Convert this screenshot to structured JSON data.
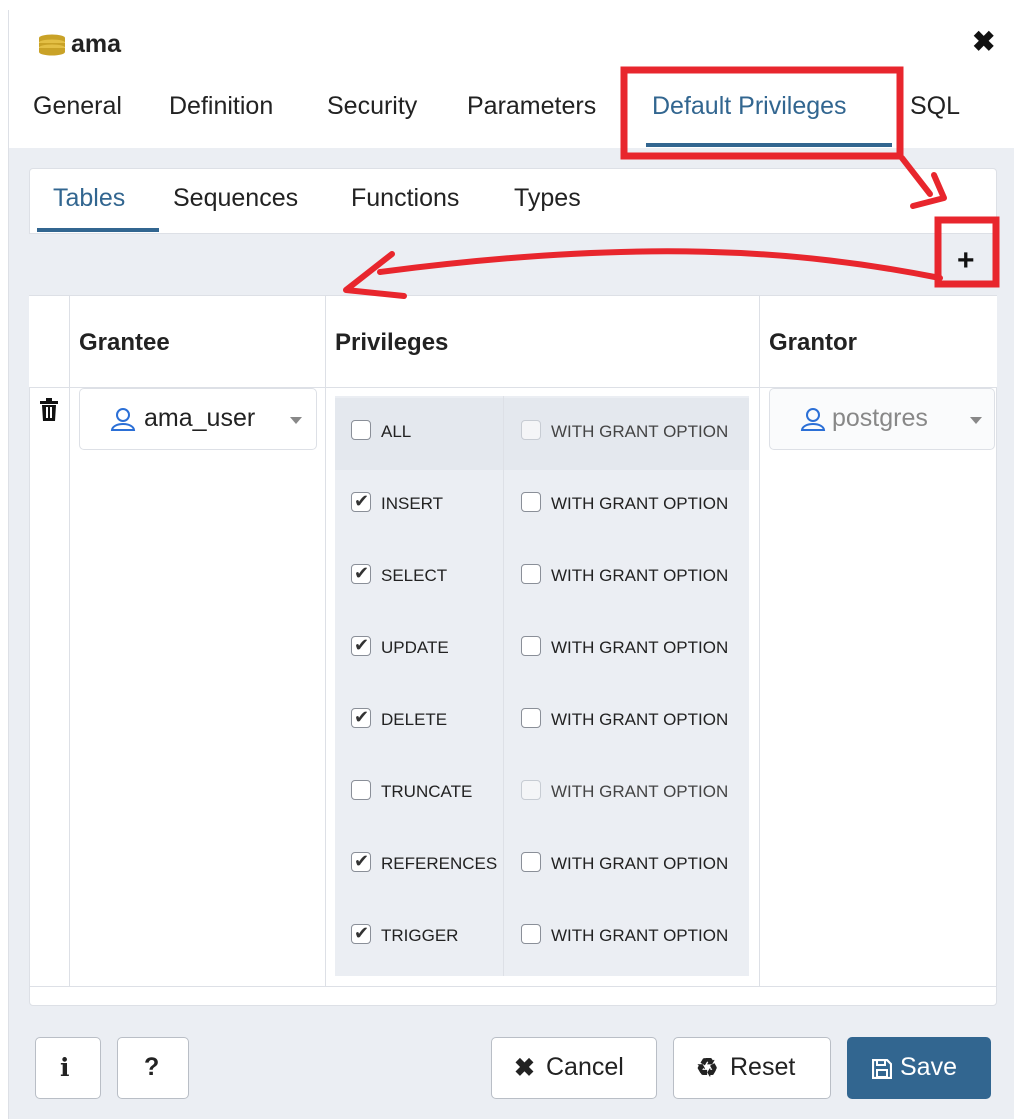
{
  "dialog": {
    "title": "ama",
    "title_icon": "database-icon",
    "close_icon": "close-icon"
  },
  "top_tabs": [
    {
      "label": "General"
    },
    {
      "label": "Definition"
    },
    {
      "label": "Security"
    },
    {
      "label": "Parameters"
    },
    {
      "label": "Default Privileges",
      "active": true
    },
    {
      "label": "SQL"
    }
  ],
  "sub_tabs": [
    {
      "label": "Tables",
      "active": true
    },
    {
      "label": "Sequences"
    },
    {
      "label": "Functions"
    },
    {
      "label": "Types"
    }
  ],
  "toolbar": {
    "add_icon": "plus-icon"
  },
  "grid": {
    "headers": {
      "grantee": "Grantee",
      "privileges": "Privileges",
      "grantor": "Grantor"
    },
    "row": {
      "delete_icon": "trash-icon",
      "grantee": "ama_user",
      "grantor": "postgres",
      "privileges": [
        {
          "name": "ALL",
          "checked": false,
          "grant_label": "WITH GRANT OPTION",
          "grant_checked": false,
          "grant_disabled": true
        },
        {
          "name": "INSERT",
          "checked": true,
          "grant_label": "WITH GRANT OPTION",
          "grant_checked": false,
          "grant_disabled": false
        },
        {
          "name": "SELECT",
          "checked": true,
          "grant_label": "WITH GRANT OPTION",
          "grant_checked": false,
          "grant_disabled": false
        },
        {
          "name": "UPDATE",
          "checked": true,
          "grant_label": "WITH GRANT OPTION",
          "grant_checked": false,
          "grant_disabled": false
        },
        {
          "name": "DELETE",
          "checked": true,
          "grant_label": "WITH GRANT OPTION",
          "grant_checked": false,
          "grant_disabled": false
        },
        {
          "name": "TRUNCATE",
          "checked": false,
          "grant_label": "WITH GRANT OPTION",
          "grant_checked": false,
          "grant_disabled": true
        },
        {
          "name": "REFERENCES",
          "checked": true,
          "grant_label": "WITH GRANT OPTION",
          "grant_checked": false,
          "grant_disabled": false
        },
        {
          "name": "TRIGGER",
          "checked": true,
          "grant_label": "WITH GRANT OPTION",
          "grant_checked": false,
          "grant_disabled": false
        }
      ]
    }
  },
  "footer": {
    "info_label": "i",
    "help_label": "?",
    "cancel_label": "Cancel",
    "reset_label": "Reset",
    "save_label": "Save"
  },
  "colors": {
    "accent": "#326690",
    "annotation": "#e8262d",
    "panel_bg": "#ebeef3"
  }
}
